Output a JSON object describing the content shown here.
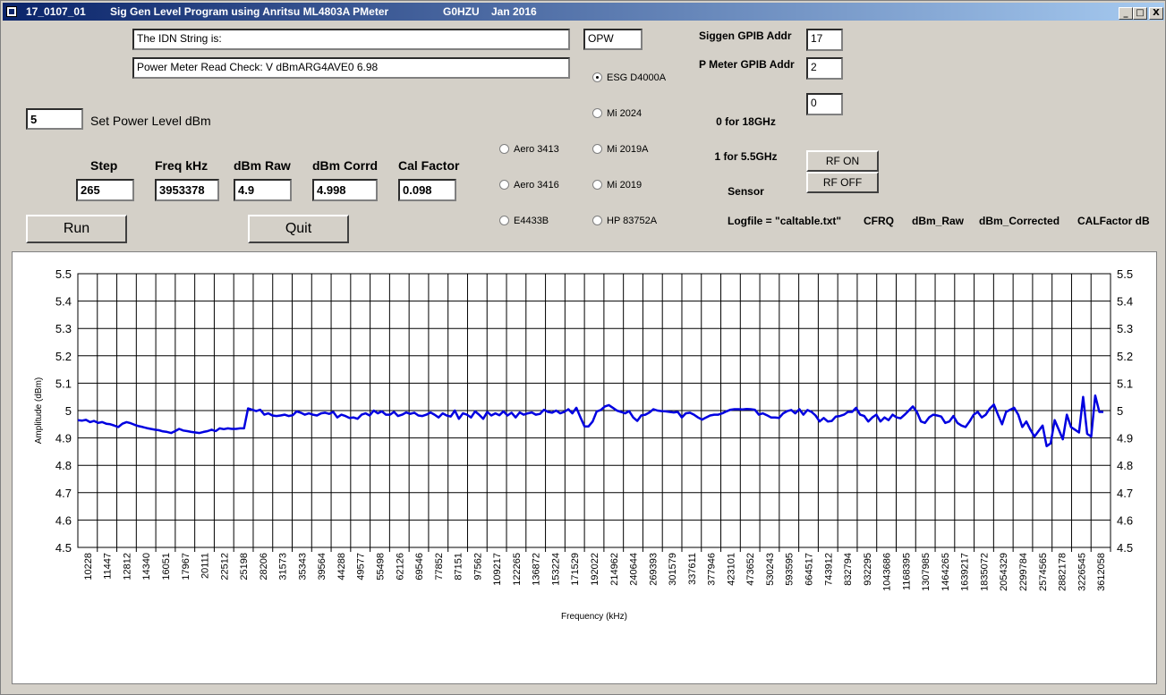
{
  "window": {
    "title_id": "17_0107_01",
    "title_program": "Sig Gen Level Program using Anritsu ML4803A PMeter",
    "title_author": "G0HZU",
    "title_date": "Jan 2016",
    "controls": {
      "minimize": "_",
      "maximize": "□",
      "close": "X"
    }
  },
  "idn": {
    "value": "The IDN String is:"
  },
  "power_meter_check": {
    "value": "Power Meter Read Check: V dBmARG4AVE0  6.98"
  },
  "opw": {
    "value": "OPW"
  },
  "gpib": {
    "siggen_label": "Siggen GPIB Addr",
    "siggen_value": "17",
    "pmeter_label": "P Meter GPIB Addr",
    "pmeter_value": "2",
    "sensor_label_1": "0 for 18GHz",
    "sensor_label_2": "1 for 5.5GHz",
    "sensor_label_3": "Sensor",
    "sensor_value": "0"
  },
  "power_level": {
    "value": "5",
    "label": "Set Power Level dBm"
  },
  "readouts": {
    "step_label": "Step",
    "step_value": "265",
    "freq_label": "Freq kHz",
    "freq_value": "3953378",
    "raw_label": "dBm Raw",
    "raw_value": "4.9",
    "corr_label": "dBm Corrd",
    "corr_value": "4.998",
    "cal_label": "Cal Factor",
    "cal_value": "0.098"
  },
  "buttons": {
    "run": "Run",
    "quit": "Quit",
    "rf_on": "RF ON",
    "rf_off": "RF OFF"
  },
  "radios": {
    "esg": "ESG D4000A",
    "mi2024": "Mi 2024",
    "mi2019a": "Mi 2019A",
    "mi2019": "Mi 2019",
    "hp": "HP 83752A",
    "aero3413": "Aero 3413",
    "aero3416": "Aero 3416",
    "e4433b": "E4433B",
    "selected": "ESG D4000A"
  },
  "logfile": {
    "name": "Logfile = \"caltable.txt\"",
    "col1": "CFRQ",
    "col2": "dBm_Raw",
    "col3": "dBm_Corrected",
    "col4": "CALFactor dB"
  },
  "chart_data": {
    "type": "line",
    "xlabel": "Frequency (kHz)",
    "ylabel": "Amplitude (dBm)",
    "ylim": [
      4.5,
      5.5
    ],
    "yticks": [
      "4.5",
      "4.6",
      "4.7",
      "4.8",
      "4.9",
      "5",
      "5.1",
      "5.2",
      "5.3",
      "5.4",
      "5.5"
    ],
    "x_tick_labels": [
      "10228",
      "11447",
      "12812",
      "14340",
      "16051",
      "17967",
      "20111",
      "22512",
      "25198",
      "28206",
      "31573",
      "35343",
      "39564",
      "44288",
      "49577",
      "55498",
      "62126",
      "69546",
      "77852",
      "87151",
      "97562",
      "109217",
      "122265",
      "136872",
      "153224",
      "171529",
      "192022",
      "214962",
      "240644",
      "269393",
      "301579",
      "337611",
      "377946",
      "423101",
      "473652",
      "530243",
      "593595",
      "664517",
      "743912",
      "832794",
      "932295",
      "1043686",
      "1168395",
      "1307985",
      "1464265",
      "1639217",
      "1835072",
      "2054329",
      "2299784",
      "2574565",
      "2882178",
      "3226545",
      "3612058"
    ],
    "grid": true,
    "line_color": "#0000e0",
    "series": [
      {
        "values": [
          4.965,
          4.963,
          4.966,
          4.958,
          4.962,
          4.955,
          4.958,
          4.952,
          4.95,
          4.945,
          4.94,
          4.952,
          4.958,
          4.954,
          4.948,
          4.943,
          4.94,
          4.936,
          4.933,
          4.93,
          4.928,
          4.924,
          4.922,
          4.918,
          4.925,
          4.933,
          4.927,
          4.925,
          4.922,
          4.92,
          4.918,
          4.922,
          4.925,
          4.93,
          4.925,
          4.935,
          4.932,
          4.935,
          4.933,
          4.933,
          4.935,
          4.935,
          5.008,
          5.003,
          4.998,
          5.003,
          4.985,
          4.99,
          4.982,
          4.98,
          4.982,
          4.985,
          4.98,
          4.983,
          4.997,
          4.992,
          4.985,
          4.99,
          4.985,
          4.982,
          4.99,
          4.992,
          4.988,
          4.995,
          4.975,
          4.985,
          4.98,
          4.973,
          4.975,
          4.97,
          4.985,
          4.99,
          4.982,
          5.0,
          4.99,
          4.997,
          4.985,
          4.985,
          4.995,
          4.98,
          4.985,
          4.993,
          4.988,
          4.992,
          4.982,
          4.98,
          4.985,
          4.993,
          4.985,
          4.975,
          4.99,
          4.982,
          4.978,
          5.0,
          4.97,
          4.99,
          4.985,
          4.975,
          4.997,
          4.985,
          4.97,
          4.995,
          4.982,
          4.99,
          4.983,
          4.997,
          4.982,
          4.992,
          4.975,
          4.993,
          4.985,
          4.99,
          4.993,
          4.985,
          4.988,
          5.003,
          4.995,
          4.992,
          5.0,
          4.99,
          4.995,
          5.005,
          4.99,
          5.01,
          4.975,
          4.942,
          4.942,
          4.96,
          4.997,
          5.002,
          5.015,
          5.02,
          5.01,
          5.0,
          4.995,
          4.99,
          4.998,
          4.975,
          4.962,
          4.982,
          4.985,
          4.993,
          5.005,
          5.0,
          4.998,
          4.997,
          4.995,
          4.993,
          4.995,
          4.975,
          4.99,
          4.992,
          4.985,
          4.975,
          4.967,
          4.975,
          4.982,
          4.985,
          4.985,
          4.99,
          4.997,
          5.003,
          5.005,
          5.005,
          5.004,
          5.006,
          5.005,
          5.003,
          4.985,
          4.99,
          4.983,
          4.975,
          4.975,
          4.973,
          4.99,
          4.998,
          5.002,
          4.99,
          5.005,
          4.985,
          5.002,
          4.995,
          4.982,
          4.96,
          4.973,
          4.96,
          4.962,
          4.978,
          4.98,
          4.985,
          4.995,
          4.995,
          5.01,
          4.985,
          4.98,
          4.96,
          4.975,
          4.985,
          4.96,
          4.975,
          4.965,
          4.985,
          4.975,
          4.972,
          4.985,
          5.0,
          5.015,
          4.995,
          4.96,
          4.955,
          4.975,
          4.985,
          4.982,
          4.978,
          4.955,
          4.96,
          4.98,
          4.955,
          4.945,
          4.94,
          4.96,
          4.985,
          4.995,
          4.975,
          4.985,
          5.008,
          5.022,
          4.985,
          4.95,
          4.995,
          5.003,
          5.01,
          4.985,
          4.94,
          4.96,
          4.93,
          4.905,
          4.925,
          4.945,
          4.87,
          4.88,
          4.965,
          4.93,
          4.895,
          4.985,
          4.94,
          4.93,
          4.92,
          5.05,
          4.915,
          4.905,
          5.055,
          4.995,
          4.995
        ]
      }
    ]
  }
}
